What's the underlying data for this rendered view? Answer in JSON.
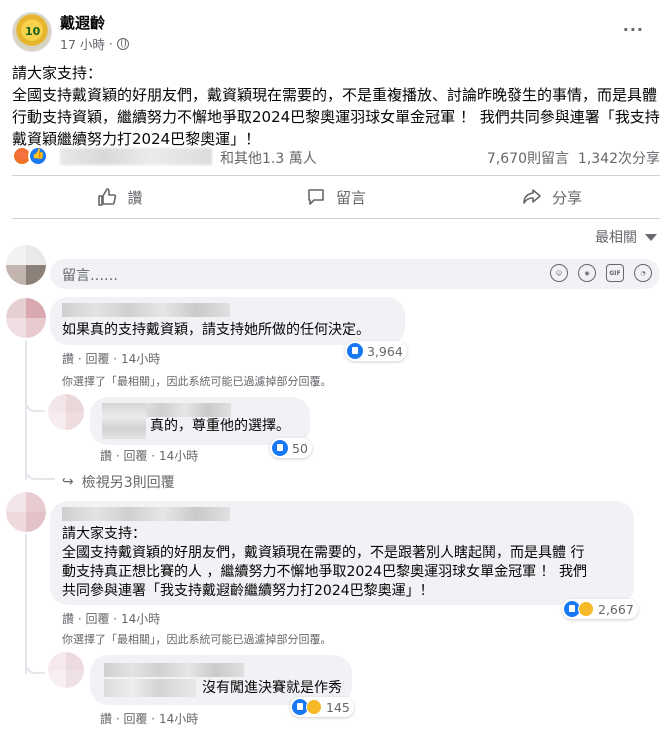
{
  "post": {
    "author": "戴遐齡",
    "time": "17 小時",
    "avatar_number": "10",
    "more": "···",
    "body_lines": [
      "請大家支持：",
      "全國支持戴資穎的好朋友們，戴資穎現在需要的，不是重複播放、討論昨晚發生的事情，而是具體",
      "行動支持資穎，繼續努力不懈地爭取2024巴黎奧運羽球女單金冠軍 ！ 我們共同參與連署「我支持",
      "戴資穎繼續努力打2024巴黎奧運」！"
    ]
  },
  "stats": {
    "others": "和其他1.3 萬人",
    "comments": "7,670則留言",
    "shares": "1,342次分享"
  },
  "actions": {
    "like": "讚",
    "comment": "留言",
    "share": "分享"
  },
  "sort_label": "最相關",
  "composer": {
    "placeholder": "留言……",
    "gif": "GIF"
  },
  "comments": [
    {
      "text": "如果真的支持戴資穎，請支持她所做的任何決定。",
      "reaction_count": "3,964",
      "action_like": "讚",
      "action_reply": "回覆",
      "time": "14小時",
      "note": "你選擇了「最相關」，因此系統可能已過濾掉部分回覆。",
      "reply": {
        "text": "真的，尊重他的選擇。",
        "reaction_count": "50",
        "action_like": "讚",
        "action_reply": "回覆",
        "time": "14小時"
      },
      "view_more": "檢視另3則回覆"
    },
    {
      "text_lines": [
        "請大家支持：",
        "全國支持戴資穎的好朋友們，戴資穎現在需要的，不是跟著別人瞎起鬨，而是具體 行",
        "動支持真正想比賽的人 ，繼續努力不懈地爭取2024巴黎奧運羽球女單金冠軍 ！ 我們",
        "共同參與連署「我支持戴遐齡繼續努力打2024巴黎奧運」！"
      ],
      "reaction_count": "2,667",
      "action_like": "讚",
      "action_reply": "回覆",
      "time": "14小時",
      "note": "你選擇了「最相關」，因此系統可能已過濾掉部分回覆。",
      "reply": {
        "text": "沒有闖進決賽就是作秀",
        "reaction_count": "145",
        "action_like": "讚",
        "action_reply": "回覆",
        "time": "14小時"
      }
    }
  ],
  "colors": {
    "text": "#050505",
    "secondary": "#65676b",
    "bubble": "#f0f2f5",
    "like_blue": "#1877f2",
    "divider": "#ced0d4"
  }
}
